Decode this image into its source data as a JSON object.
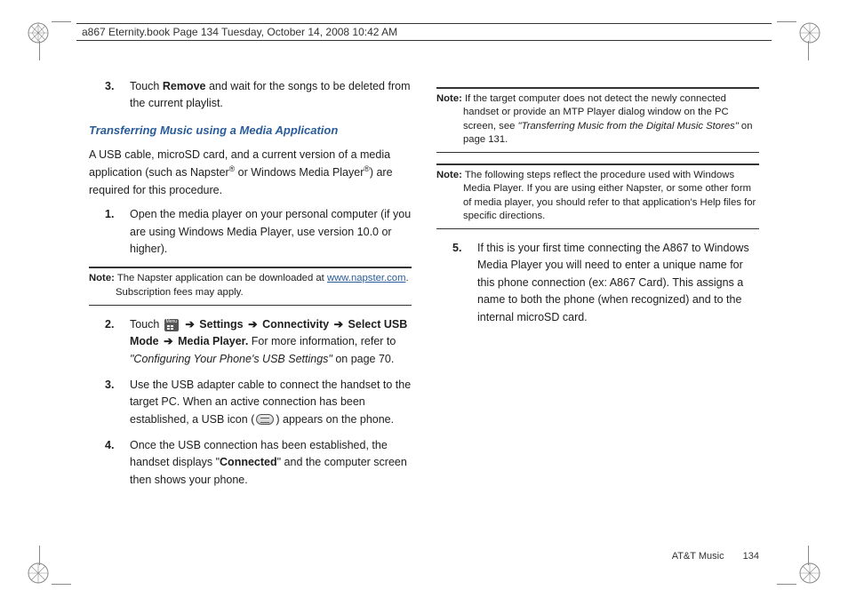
{
  "header": {
    "running": "a867 Eternity.book  Page 134  Tuesday, October 14, 2008  10:42 AM"
  },
  "left": {
    "step3a": {
      "num": "3.",
      "pre": "Touch ",
      "bold": "Remove",
      "post": " and wait for the songs to be deleted from the current playlist."
    },
    "heading": "Transferring Music using a Media Application",
    "intro": {
      "t1": "A USB cable, microSD card, and a current version of a media application (such as Napster",
      "t2": " or Windows Media Player",
      "t3": ") are required for this procedure."
    },
    "step1": {
      "num": "1.",
      "text": "Open the media player on your personal computer (if you are using Windows Media Player, use version 10.0 or higher)."
    },
    "note1": {
      "label": "Note:",
      "t1": "The Napster application can be downloaded at ",
      "link": "www.napster.com",
      "t2": ". Subscription fees may apply."
    },
    "step2": {
      "num": "2.",
      "touch": "Touch ",
      "settings": "Settings",
      "connectivity": "Connectivity",
      "selectusb": "Select USB Mode",
      "mediaplayer": "Media Player.",
      "more_pre": " For more information, refer to ",
      "more_ital": "\"Configuring Your Phone's USB Settings\" ",
      "more_post": " on page 70."
    },
    "step3b": {
      "num": "3.",
      "pre": "Use the USB adapter cable to connect the handset to the target PC. When an active connection has been established, a USB icon (",
      "post": ") appears on the phone."
    },
    "step4": {
      "num": "4.",
      "pre": "Once the USB connection has been established, the handset displays \"",
      "bold": "Connected",
      "post": "\" and the computer screen then shows your phone."
    }
  },
  "right": {
    "note2": {
      "label": "Note:",
      "t1": "If the target computer does not detect the newly connected handset or provide an MTP Player dialog window on the PC screen, see ",
      "ital": "\"Transferring Music from the Digital Music Stores\"",
      "t2": " on page 131."
    },
    "note3": {
      "label": "Note:",
      "text": "The following steps reflect the procedure used with Windows Media Player. If you are using either Napster, or some other form of media player, you should refer to that application's Help files for specific directions."
    },
    "step5": {
      "num": "5.",
      "text": "If this is your first time connecting the A867 to Windows Media Player you will need to enter a unique name for this phone connection (ex: A867 Card). This assigns a name to both the phone (when recognized) and to the internal microSD card."
    }
  },
  "footer": {
    "section": "AT&T Music",
    "page": "134"
  },
  "icons": {
    "menu": "menu-icon",
    "usb": "usb-icon",
    "arrow": "➔"
  }
}
